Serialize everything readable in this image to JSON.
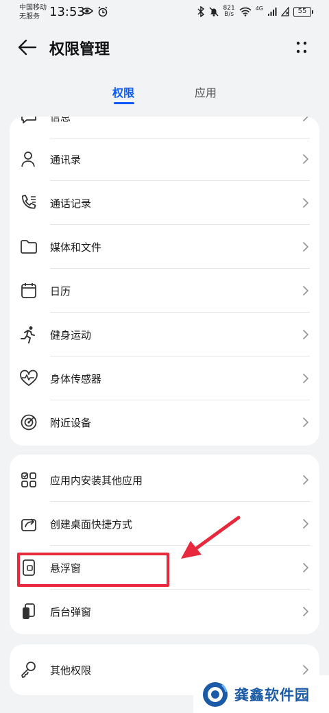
{
  "status_bar": {
    "carrier_line1": "中国移动",
    "carrier_line2": "无服务",
    "time": "13:53",
    "net_speed_value": "821",
    "net_speed_unit": "B/s",
    "network_type": "4G",
    "battery": "55"
  },
  "header": {
    "title": "权限管理",
    "back_icon": "arrow-left-icon",
    "more_icon": "more-dots-icon"
  },
  "tabs": [
    {
      "label": "权限",
      "active": true
    },
    {
      "label": "应用",
      "active": false
    }
  ],
  "permissions_group1": [
    {
      "label": "信息",
      "icon": "message-icon"
    },
    {
      "label": "通讯录",
      "icon": "contacts-icon"
    },
    {
      "label": "通话记录",
      "icon": "call-log-icon"
    },
    {
      "label": "媒体和文件",
      "icon": "folder-icon"
    },
    {
      "label": "日历",
      "icon": "calendar-icon"
    },
    {
      "label": "健身运动",
      "icon": "running-icon"
    },
    {
      "label": "身体传感器",
      "icon": "heart-rate-icon"
    },
    {
      "label": "附近设备",
      "icon": "nearby-icon"
    }
  ],
  "permissions_group2": [
    {
      "label": "应用内安装其他应用",
      "icon": "app-grid-icon"
    },
    {
      "label": "创建桌面快捷方式",
      "icon": "shortcut-icon"
    },
    {
      "label": "悬浮窗",
      "icon": "floating-window-icon"
    },
    {
      "label": "后台弹窗",
      "icon": "background-popup-icon"
    }
  ],
  "permissions_group3": [
    {
      "label": "其他权限",
      "icon": "key-icon"
    }
  ],
  "annotation": {
    "color": "#e8283d"
  },
  "watermark": {
    "text": "龚鑫软件园"
  },
  "colors": {
    "accent": "#0a59f7",
    "background": "#f1f3f5",
    "card": "#ffffff"
  }
}
